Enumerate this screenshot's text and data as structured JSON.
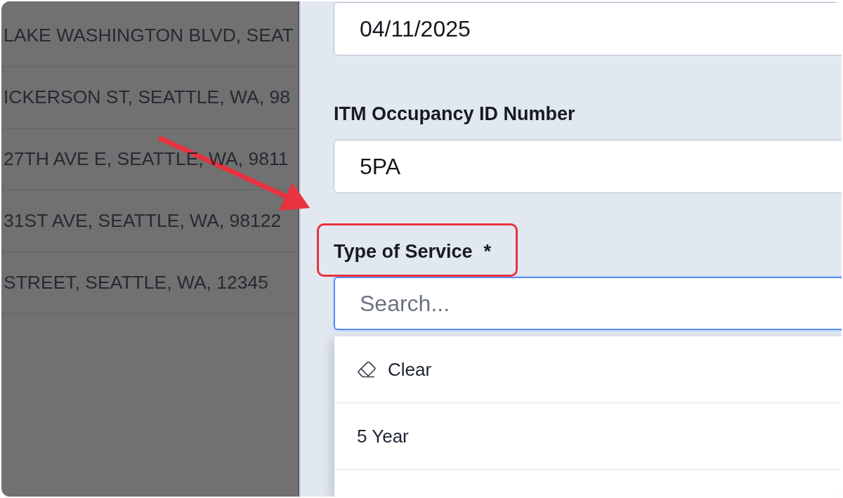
{
  "background_table": {
    "rows": [
      {
        "column_1": "LAKE WASHINGTON BLVD, SEAT"
      },
      {
        "column_1": "ICKERSON ST, SEATTLE, WA, 98"
      },
      {
        "column_1": "27TH AVE E, SEATTLE, WA, 9811"
      },
      {
        "column_1": "31ST AVE, SEATTLE, WA, 98122"
      },
      {
        "column_1": "STREET, SEATTLE, WA, 12345"
      }
    ]
  },
  "form": {
    "fields": [
      {
        "kind": "text",
        "value": "04/11/2025",
        "focused": false
      },
      {
        "kind": "text",
        "label": "ITM Occupancy ID Number",
        "value": "5PA",
        "focused": false
      },
      {
        "kind": "select",
        "label": "Type of Service",
        "required_mark": "*",
        "highlighted": true,
        "focused": true,
        "placeholder": "Search...",
        "options": [
          {
            "kind": "clear",
            "label": "Clear",
            "selected": false
          },
          {
            "kind": "option",
            "label": "5 Year",
            "selected": false
          }
        ]
      }
    ]
  }
}
